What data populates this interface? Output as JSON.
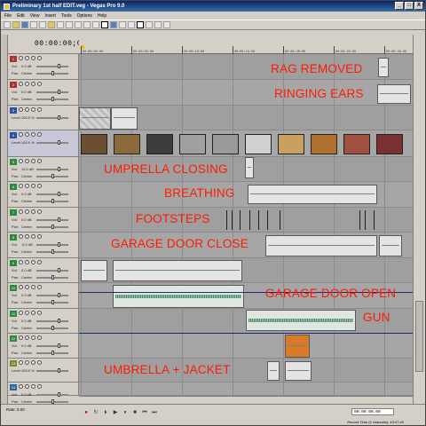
{
  "window": {
    "title": "Preliminary 1st half EDIT.veg - Vegas Pro 9.0",
    "minimize": "_",
    "maximize": "□",
    "close": "X"
  },
  "menu": [
    "File",
    "Edit",
    "View",
    "Insert",
    "Tools",
    "Options",
    "Help"
  ],
  "timecode": "00:00:00;00",
  "ruler": {
    "labels": [
      "00:00:00:00",
      "00:00:05:00",
      "00:00:10:00",
      "00:00:15:00",
      "00:00:20:00",
      "00:00:25:00",
      "00:00:30:00"
    ]
  },
  "tracks": [
    {
      "num": "1",
      "color": "#b03030",
      "vol_label": "Vol:",
      "vol": "0.0 dB",
      "pan_label": "Pan:",
      "pan": "Center"
    },
    {
      "num": "2",
      "color": "#b03030",
      "vol_label": "Vol:",
      "vol": "0.0 dB",
      "pan_label": "Pan:",
      "pan": "Center"
    },
    {
      "num": "3",
      "color": "#3050a0",
      "vol_label": "Level:",
      "vol": "100.0 %",
      "pan_label": "",
      "pan": ""
    },
    {
      "num": "4",
      "color": "#3050a0",
      "vol_label": "Level:",
      "vol": "100.0 %",
      "pan_label": "",
      "pan": ""
    },
    {
      "num": "5",
      "color": "#2a8a3a",
      "vol_label": "Vol:",
      "vol": "12.0 dB",
      "pan_label": "Pan:",
      "pan": "Center"
    },
    {
      "num": "6",
      "color": "#2a8a3a",
      "vol_label": "Vol:",
      "vol": "0.0 dB",
      "pan_label": "Pan:",
      "pan": "Center"
    },
    {
      "num": "7",
      "color": "#2a8a3a",
      "vol_label": "Vol:",
      "vol": "0.0 dB",
      "pan_label": "Pan:",
      "pan": "Center"
    },
    {
      "num": "8",
      "color": "#2a8a3a",
      "vol_label": "Vol:",
      "vol": "-6.0 dB",
      "pan_label": "Pan:",
      "pan": "Center"
    },
    {
      "num": "9",
      "color": "#2a8a3a",
      "vol_label": "Vol:",
      "vol": "0.0 dB",
      "pan_label": "Pan:",
      "pan": "Center"
    },
    {
      "num": "10",
      "color": "#2a8a3a",
      "vol_label": "Vol:",
      "vol": "0.0 dB",
      "pan_label": "Pan:",
      "pan": "Center"
    },
    {
      "num": "11",
      "color": "#2a8a3a",
      "vol_label": "Vol:",
      "vol": "0.0 dB",
      "pan_label": "Pan:",
      "pan": "Center"
    },
    {
      "num": "12",
      "color": "#2a8a3a",
      "vol_label": "Vol:",
      "vol": "0.0 dB",
      "pan_label": "Pan:",
      "pan": "Center"
    },
    {
      "num": "13",
      "color": "#7a8a2a",
      "vol_label": "Level:",
      "vol": "100.0 %",
      "pan_label": "",
      "pan": ""
    },
    {
      "num": "14",
      "color": "#2a6a9a",
      "vol_label": "Vol:",
      "vol": "0.0 dB",
      "pan_label": "Pan:",
      "pan": "Center"
    }
  ],
  "annotations": {
    "rag_removed": "RAG REMOVED",
    "ringing_ears": "RINGING EARS",
    "umbrella_closing": "UMPRELLA CLOSING",
    "breathing": "BREATHING",
    "footsteps": "FOOTSTEPS",
    "garage_door_close": "GARAGE DOOR CLOSE",
    "garage_door_open": "GARAGE DOOR OPEN",
    "gun": "GUN",
    "umbrella_jacket": "UMBRELLA + JACKET"
  },
  "bottom": {
    "rate": "Rate: 0.00",
    "time": "00:00:00;00",
    "record_time": "Record Time (2 channels): 43:47:40"
  },
  "colors": {
    "annotation": "#ff1a00",
    "title_bar": "#0a246a"
  }
}
